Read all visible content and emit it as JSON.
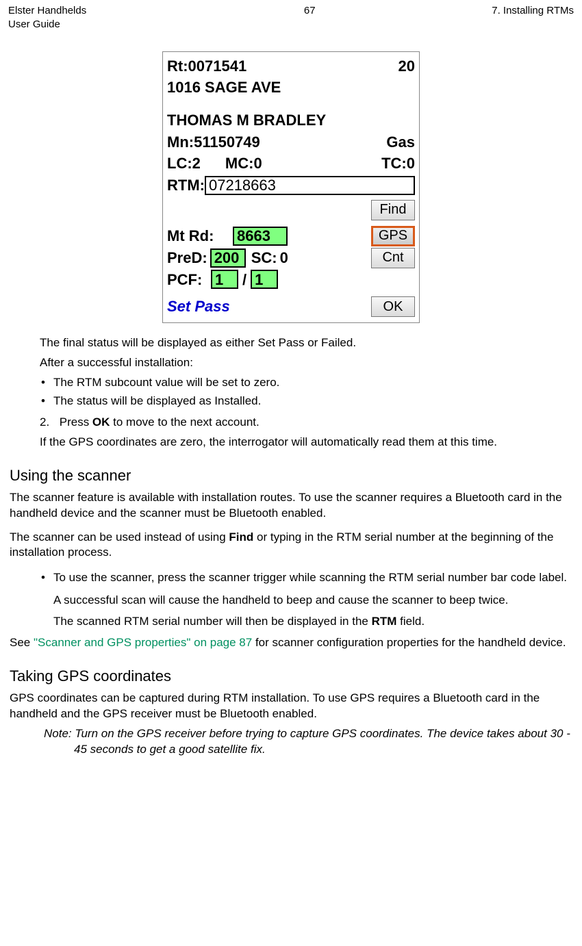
{
  "header": {
    "title": "Elster Handhelds",
    "subtitle": "User Guide",
    "page": "67",
    "chapter": "7. Installing RTMs"
  },
  "screen": {
    "rt_label": "Rt:",
    "rt_value": "0071541",
    "rt_count": "20",
    "address": "1016 SAGE AVE",
    "name": "THOMAS M BRADLEY",
    "mn_label": "Mn:",
    "mn_value": "51150749",
    "meter_type": "Gas",
    "lc_label": "LC:",
    "lc_value": "2",
    "mc_label": "MC:",
    "mc_value": "0",
    "tc_label": "TC:",
    "tc_value": "0",
    "rtm_label": "RTM:",
    "rtm_value": "07218663",
    "find_label": "Find",
    "mtrd_label": "Mt Rd:",
    "mtrd_value": "8663",
    "gps_label": "GPS",
    "pred_label": "PreD:",
    "pred_value": "200",
    "sc_label": "SC:",
    "sc_value": "0",
    "cnt_label": "Cnt",
    "pcf_label": "PCF:",
    "pcf_a": "1",
    "pcf_sep": "/",
    "pcf_b": "1",
    "status": "Set Pass",
    "ok_label": "OK"
  },
  "text": {
    "p1": "The final status will be displayed as either Set Pass or Failed.",
    "p2": "After a successful installation:",
    "b1": "The RTM subcount value will be set to zero.",
    "b2": "The status will be displayed as Installed.",
    "n2_pre": "Press ",
    "n2_bold": "OK",
    "n2_post": " to move to the next account.",
    "p3": "If the GPS coordinates are zero, the interrogator will automatically read them at this time.",
    "h1": "Using the scanner",
    "p4": "The scanner feature is available with installation routes. To use the scanner requires a Bluetooth card in the handheld device and the scanner must be Bluetooth enabled.",
    "p5a": "The scanner can be used instead of using ",
    "p5bold": "Find",
    "p5b": " or typing in the RTM serial number at the beginning of the installation process.",
    "b3": "To use the scanner, press the scanner trigger while scanning the RTM serial number bar code label.",
    "p6": "A successful scan will cause the handheld to beep and cause the scanner to beep twice.",
    "p7a": "The scanned RTM serial number will then be displayed in the ",
    "p7bold": "RTM",
    "p7b": " field.",
    "p8a": "See ",
    "p8link": "\"Scanner and GPS properties\" on page 87",
    "p8b": " for scanner configuration properties for the handheld device.",
    "h2": "Taking GPS coordinates",
    "p9": "GPS coordinates can be captured during RTM installation. To use GPS requires a Bluetooth card in the handheld and the GPS receiver must be Bluetooth enabled.",
    "note": "Note: Turn on the GPS receiver before trying to capture GPS coordinates. The device takes about 30 - 45 seconds to get a good satellite fix."
  }
}
